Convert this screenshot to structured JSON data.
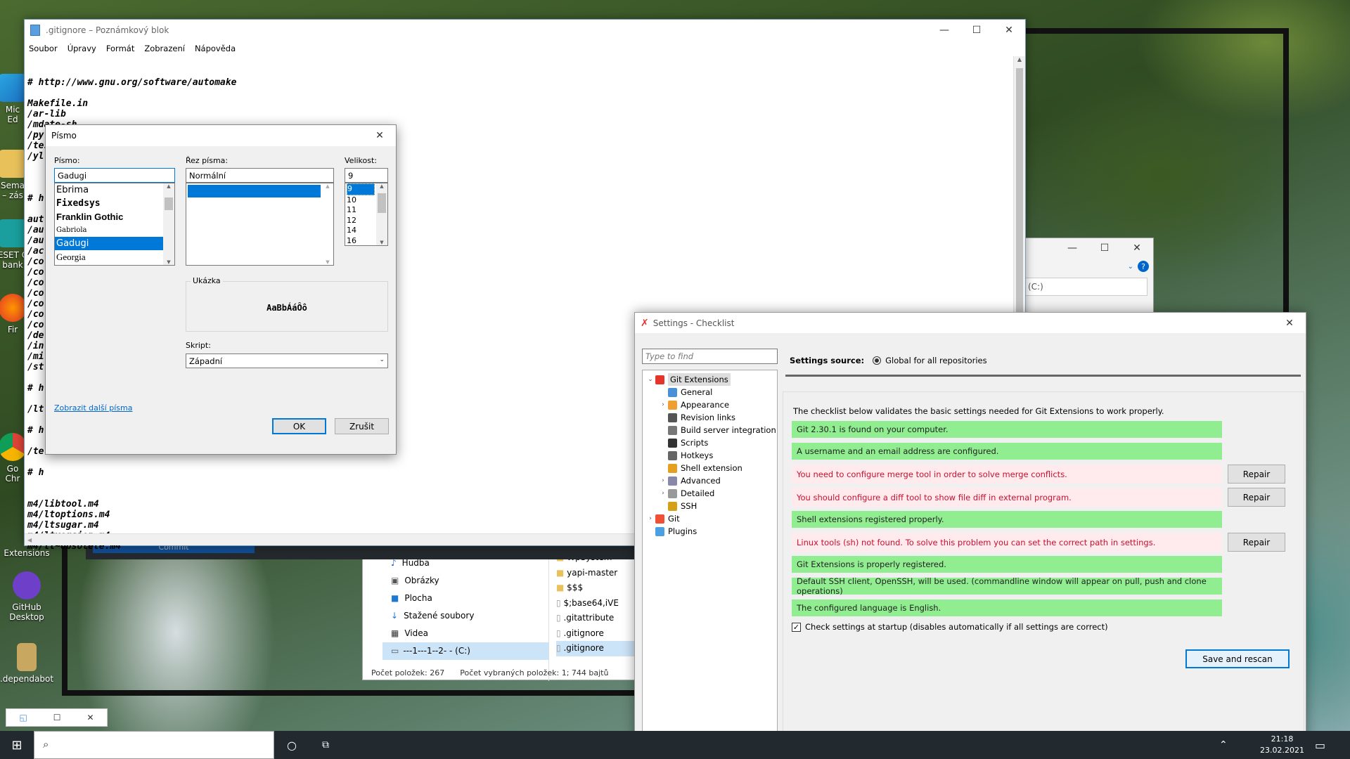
{
  "desktop": {
    "icons": [
      {
        "label": "Mic\nEd",
        "name": "desktop-icon-edge"
      },
      {
        "label": "Sema\n– zás",
        "name": "desktop-icon-folder"
      },
      {
        "label": "ESET C\nbank",
        "name": "desktop-icon-eset"
      },
      {
        "label": "Fir",
        "name": "desktop-icon-firefox"
      },
      {
        "label": "Go\nChr",
        "name": "desktop-icon-chrome"
      },
      {
        "label": "Extensions",
        "name": "desktop-icon-git-extensions"
      },
      {
        "label": "GitHub\nDesktop",
        "name": "desktop-icon-github-desktop"
      },
      {
        "label": ".dependabot",
        "name": "desktop-icon-dependabot"
      }
    ]
  },
  "notepad": {
    "title": ".gitignore – Poznámkový blok",
    "menu": [
      "Soubor",
      "Úpravy",
      "Formát",
      "Zobrazení",
      "Nápověda"
    ],
    "lines_top": [
      "# http://www.gnu.org/software/automake",
      "",
      "Makefile.in",
      "/ar-lib",
      "/mdate-sh",
      "/py-compile",
      "/test-driver",
      "/yl"
    ],
    "lines_left": [
      "",
      "# h",
      "",
      "aut",
      "/au",
      "/au",
      "/ac",
      "/co",
      "/co",
      "/co",
      "/co",
      "/co",
      "/co",
      "/co",
      "/de",
      "/in",
      "/mi",
      "/st",
      "",
      "# h",
      "",
      "/lt",
      "",
      "# h",
      "",
      "/te",
      "",
      "# h"
    ],
    "lines_bottom": [
      "m4/libtool.m4",
      "m4/ltoptions.m4",
      "m4/ltsugar.m4",
      "m4/ltversion.m4",
      "m4/lt~obsolete.m4"
    ]
  },
  "font_dialog": {
    "title": "Písmo",
    "font_label": "Písmo:",
    "font_value": "Gadugi",
    "fonts": [
      "Ebrima",
      "Fixedsys",
      "Franklin Gothic",
      "Gabriola",
      "Gadugi",
      "Georgia"
    ],
    "style_label": "Řez písma:",
    "style_value": "Normální",
    "size_label": "Velikost:",
    "size_value": "9",
    "sizes": [
      "9",
      "10",
      "11",
      "12",
      "14",
      "16",
      "18"
    ],
    "sample_label": "Ukázka",
    "sample_text": "AaBbÁáÔô",
    "script_label": "Skript:",
    "script_value": "Západní",
    "more_fonts_link": "Zobrazit další písma",
    "ok": "OK",
    "cancel": "Zrušit"
  },
  "explorer": {
    "left_items": [
      "Hudba",
      "Obrázky",
      "Plocha",
      "Stažené soubory",
      "Videa",
      "---1---1--2- - (C:)"
    ],
    "right_items": [
      "WpSystem",
      "yapi-master",
      "$$$",
      "$;base64,iVE",
      ".gitattribute",
      ".gitignore",
      ".gitignore"
    ],
    "status_count": "Počet položek: 267",
    "status_selected": "Počet vybraných položek: 1; 744 bajtů",
    "commit_label": "Commit"
  },
  "small_window": {
    "path": "(C:)"
  },
  "git_settings": {
    "title": "Settings - Checklist",
    "search_placeholder": "Type to find",
    "settings_source_label": "Settings source:",
    "settings_source_value": "Global for all repositories",
    "tree": [
      {
        "label": "Git Extensions",
        "level": 0,
        "expander": "v",
        "icon": "git-extensions-icon",
        "color": "#e5352b"
      },
      {
        "label": "General",
        "level": 1,
        "expander": "",
        "icon": "home-icon",
        "color": "#4a90d9"
      },
      {
        "label": "Appearance",
        "level": 1,
        "expander": ">",
        "icon": "palette-icon",
        "color": "#f0a030"
      },
      {
        "label": "Revision links",
        "level": 1,
        "expander": "",
        "icon": "link-icon",
        "color": "#555555"
      },
      {
        "label": "Build server integration",
        "level": 1,
        "expander": "",
        "icon": "build-icon",
        "color": "#777777"
      },
      {
        "label": "Scripts",
        "level": 1,
        "expander": "",
        "icon": "terminal-icon",
        "color": "#333333"
      },
      {
        "label": "Hotkeys",
        "level": 1,
        "expander": "",
        "icon": "keyboard-icon",
        "color": "#666666"
      },
      {
        "label": "Shell extension",
        "level": 1,
        "expander": "",
        "icon": "shell-icon",
        "color": "#e5a020"
      },
      {
        "label": "Advanced",
        "level": 1,
        "expander": ">",
        "icon": "advanced-icon",
        "color": "#8888aa"
      },
      {
        "label": "Detailed",
        "level": 1,
        "expander": ">",
        "icon": "gear-icon",
        "color": "#999999"
      },
      {
        "label": "SSH",
        "level": 1,
        "expander": "",
        "icon": "key-icon",
        "color": "#d4a017"
      },
      {
        "label": "Git",
        "level": 0,
        "expander": ">",
        "icon": "git-icon",
        "color": "#f05033"
      },
      {
        "label": "Plugins",
        "level": 0,
        "expander": "",
        "icon": "plugins-icon",
        "color": "#4aa0e0"
      }
    ],
    "intro": "The checklist below validates the basic settings needed for Git Extensions to work properly.",
    "checks": [
      {
        "text": "Git 2.30.1 is found on your computer.",
        "status": "ok",
        "repair": false
      },
      {
        "text": "A username and an email address are configured.",
        "status": "ok",
        "repair": false
      },
      {
        "text": "You need to configure merge tool in order to solve merge conflicts.",
        "status": "bad",
        "repair": true
      },
      {
        "text": "You should configure a diff tool to show file diff in external program.",
        "status": "bad",
        "repair": true
      },
      {
        "text": "Shell extensions registered properly.",
        "status": "ok",
        "repair": false
      },
      {
        "text": "Linux tools (sh) not found. To solve this problem you can set the correct path in settings.",
        "status": "bad",
        "repair": true
      },
      {
        "text": "Git Extensions is properly registered.",
        "status": "ok",
        "repair": false
      },
      {
        "text": "Default SSH client, OpenSSH, will be used. (commandline window will appear on pull, push and clone operations)",
        "status": "ok",
        "repair": false
      },
      {
        "text": "The configured language is English.",
        "status": "ok",
        "repair": false
      }
    ],
    "repair_label": "Repair",
    "check_startup_label": "Check settings at startup (disables automatically if all settings are correct)",
    "check_startup_checked": true,
    "save_rescan": "Save and rescan"
  },
  "taskbar": {
    "time": "21:18",
    "date": "23.02.2021"
  }
}
